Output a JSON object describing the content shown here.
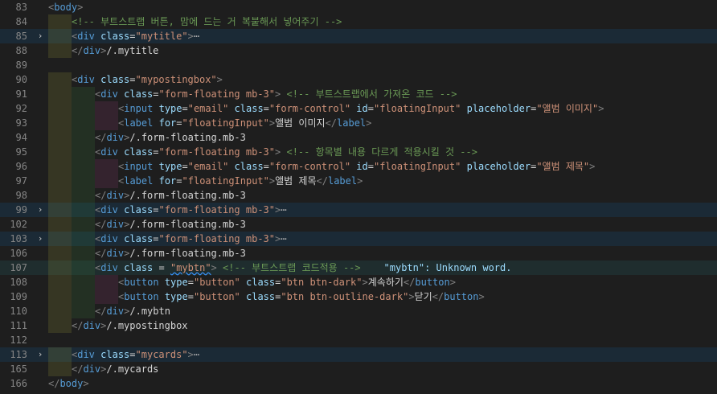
{
  "editor": {
    "lines": [
      {
        "num": "83",
        "fold": "",
        "indent": [],
        "tokens": [
          [
            "t-punc",
            "<"
          ],
          [
            "t-tag",
            "body"
          ],
          [
            "t-punc",
            ">"
          ]
        ]
      },
      {
        "num": "84",
        "fold": "",
        "indent": [
          "g1"
        ],
        "tokens": [
          [
            "t-com",
            "<!-- 부트스트랩 버튼, 맘에 드는 거 복붙해서 넣어주기 -->"
          ]
        ]
      },
      {
        "num": "85",
        "fold": "›",
        "hl": true,
        "indent": [
          "g1"
        ],
        "tokens": [
          [
            "t-punc",
            "<"
          ],
          [
            "t-tag",
            "div"
          ],
          [
            "t-text",
            " "
          ],
          [
            "t-attr",
            "class"
          ],
          [
            "t-text",
            "="
          ],
          [
            "t-str",
            "\"mytitle\""
          ],
          [
            "t-punc",
            ">"
          ],
          [
            "t-ellip",
            "⋯"
          ]
        ]
      },
      {
        "num": "88",
        "fold": "",
        "indent": [
          "g1"
        ],
        "tokens": [
          [
            "t-punc",
            "</"
          ],
          [
            "t-tag",
            "div"
          ],
          [
            "t-punc",
            ">"
          ],
          [
            "t-text",
            "/.mytitle"
          ]
        ]
      },
      {
        "num": "89",
        "fold": "",
        "indent": [],
        "tokens": []
      },
      {
        "num": "90",
        "fold": "",
        "indent": [
          "g1"
        ],
        "tokens": [
          [
            "t-punc",
            "<"
          ],
          [
            "t-tag",
            "div"
          ],
          [
            "t-text",
            " "
          ],
          [
            "t-attr",
            "class"
          ],
          [
            "t-text",
            "="
          ],
          [
            "t-str",
            "\"mypostingbox\""
          ],
          [
            "t-punc",
            ">"
          ]
        ]
      },
      {
        "num": "91",
        "fold": "",
        "indent": [
          "g1",
          "g2"
        ],
        "tokens": [
          [
            "t-punc",
            "<"
          ],
          [
            "t-tag",
            "div"
          ],
          [
            "t-text",
            " "
          ],
          [
            "t-attr",
            "class"
          ],
          [
            "t-text",
            "="
          ],
          [
            "t-str",
            "\"form-floating mb-3\""
          ],
          [
            "t-punc",
            ">"
          ],
          [
            "t-text",
            " "
          ],
          [
            "t-com",
            "<!-- 부트스트랩에서 가져온 코드 -->"
          ]
        ]
      },
      {
        "num": "92",
        "fold": "",
        "indent": [
          "g1",
          "g2",
          "g3"
        ],
        "tokens": [
          [
            "t-punc",
            "<"
          ],
          [
            "t-tag",
            "input"
          ],
          [
            "t-text",
            " "
          ],
          [
            "t-attr",
            "type"
          ],
          [
            "t-text",
            "="
          ],
          [
            "t-str",
            "\"email\""
          ],
          [
            "t-text",
            " "
          ],
          [
            "t-attr",
            "class"
          ],
          [
            "t-text",
            "="
          ],
          [
            "t-str",
            "\"form-control\""
          ],
          [
            "t-text",
            " "
          ],
          [
            "t-attr",
            "id"
          ],
          [
            "t-text",
            "="
          ],
          [
            "t-str",
            "\"floatingInput\""
          ],
          [
            "t-text",
            " "
          ],
          [
            "t-attr",
            "placeholder"
          ],
          [
            "t-text",
            "="
          ],
          [
            "t-str",
            "\"앨범 이미지\""
          ],
          [
            "t-punc",
            ">"
          ]
        ]
      },
      {
        "num": "93",
        "fold": "",
        "indent": [
          "g1",
          "g2",
          "g3"
        ],
        "tokens": [
          [
            "t-punc",
            "<"
          ],
          [
            "t-tag",
            "label"
          ],
          [
            "t-text",
            " "
          ],
          [
            "t-attr",
            "for"
          ],
          [
            "t-text",
            "="
          ],
          [
            "t-str",
            "\"floatingInput\""
          ],
          [
            "t-punc",
            ">"
          ],
          [
            "t-text",
            "앨범 이미지"
          ],
          [
            "t-punc",
            "</"
          ],
          [
            "t-tag",
            "label"
          ],
          [
            "t-punc",
            ">"
          ]
        ]
      },
      {
        "num": "94",
        "fold": "",
        "indent": [
          "g1",
          "g2"
        ],
        "tokens": [
          [
            "t-punc",
            "</"
          ],
          [
            "t-tag",
            "div"
          ],
          [
            "t-punc",
            ">"
          ],
          [
            "t-text",
            "/.form-floating.mb-3"
          ]
        ]
      },
      {
        "num": "95",
        "fold": "",
        "indent": [
          "g1",
          "g2"
        ],
        "tokens": [
          [
            "t-punc",
            "<"
          ],
          [
            "t-tag",
            "div"
          ],
          [
            "t-text",
            " "
          ],
          [
            "t-attr",
            "class"
          ],
          [
            "t-text",
            "="
          ],
          [
            "t-str",
            "\"form-floating mb-3\""
          ],
          [
            "t-punc",
            ">"
          ],
          [
            "t-text",
            " "
          ],
          [
            "t-com",
            "<!-- 항목별 내용 다르게 적용시킬 것 -->"
          ]
        ]
      },
      {
        "num": "96",
        "fold": "",
        "indent": [
          "g1",
          "g2",
          "g3"
        ],
        "tokens": [
          [
            "t-punc",
            "<"
          ],
          [
            "t-tag",
            "input"
          ],
          [
            "t-text",
            " "
          ],
          [
            "t-attr",
            "type"
          ],
          [
            "t-text",
            "="
          ],
          [
            "t-str",
            "\"email\""
          ],
          [
            "t-text",
            " "
          ],
          [
            "t-attr",
            "class"
          ],
          [
            "t-text",
            "="
          ],
          [
            "t-str",
            "\"form-control\""
          ],
          [
            "t-text",
            " "
          ],
          [
            "t-attr",
            "id"
          ],
          [
            "t-text",
            "="
          ],
          [
            "t-str",
            "\"floatingInput\""
          ],
          [
            "t-text",
            " "
          ],
          [
            "t-attr",
            "placeholder"
          ],
          [
            "t-text",
            "="
          ],
          [
            "t-str",
            "\"앨범 제목\""
          ],
          [
            "t-punc",
            ">"
          ]
        ]
      },
      {
        "num": "97",
        "fold": "",
        "indent": [
          "g1",
          "g2",
          "g3"
        ],
        "tokens": [
          [
            "t-punc",
            "<"
          ],
          [
            "t-tag",
            "label"
          ],
          [
            "t-text",
            " "
          ],
          [
            "t-attr",
            "for"
          ],
          [
            "t-text",
            "="
          ],
          [
            "t-str",
            "\"floatingInput\""
          ],
          [
            "t-punc",
            ">"
          ],
          [
            "t-text",
            "앨범 제목"
          ],
          [
            "t-punc",
            "</"
          ],
          [
            "t-tag",
            "label"
          ],
          [
            "t-punc",
            ">"
          ]
        ]
      },
      {
        "num": "98",
        "fold": "",
        "indent": [
          "g1",
          "g2"
        ],
        "tokens": [
          [
            "t-punc",
            "</"
          ],
          [
            "t-tag",
            "div"
          ],
          [
            "t-punc",
            ">"
          ],
          [
            "t-text",
            "/.form-floating.mb-3"
          ]
        ]
      },
      {
        "num": "99",
        "fold": "›",
        "hl": true,
        "indent": [
          "g1",
          "g2"
        ],
        "tokens": [
          [
            "t-punc",
            "<"
          ],
          [
            "t-tag",
            "div"
          ],
          [
            "t-text",
            " "
          ],
          [
            "t-attr",
            "class"
          ],
          [
            "t-text",
            "="
          ],
          [
            "t-str",
            "\"form-floating mb-3\""
          ],
          [
            "t-punc",
            ">"
          ],
          [
            "t-ellip",
            "⋯"
          ]
        ]
      },
      {
        "num": "102",
        "fold": "",
        "indent": [
          "g1",
          "g2"
        ],
        "tokens": [
          [
            "t-punc",
            "</"
          ],
          [
            "t-tag",
            "div"
          ],
          [
            "t-punc",
            ">"
          ],
          [
            "t-text",
            "/.form-floating.mb-3"
          ]
        ]
      },
      {
        "num": "103",
        "fold": "›",
        "hl": true,
        "indent": [
          "g1",
          "g2"
        ],
        "tokens": [
          [
            "t-punc",
            "<"
          ],
          [
            "t-tag",
            "div"
          ],
          [
            "t-text",
            " "
          ],
          [
            "t-attr",
            "class"
          ],
          [
            "t-text",
            "="
          ],
          [
            "t-str",
            "\"form-floating mb-3\""
          ],
          [
            "t-punc",
            ">"
          ],
          [
            "t-ellip",
            "⋯"
          ]
        ]
      },
      {
        "num": "106",
        "fold": "",
        "indent": [
          "g1",
          "g2"
        ],
        "tokens": [
          [
            "t-punc",
            "</"
          ],
          [
            "t-tag",
            "div"
          ],
          [
            "t-punc",
            ">"
          ],
          [
            "t-text",
            "/.form-floating.mb-3"
          ]
        ]
      },
      {
        "num": "107",
        "fold": "",
        "cur": true,
        "indent": [
          "g1",
          "g2"
        ],
        "tokens": [
          [
            "t-punc",
            "<"
          ],
          [
            "t-tag",
            "div"
          ],
          [
            "t-text",
            " "
          ],
          [
            "t-attr",
            "class"
          ],
          [
            "t-text",
            " = "
          ],
          [
            "t-str squiggle",
            "\"mybtn\""
          ],
          [
            "t-punc",
            ">"
          ],
          [
            "t-text",
            " "
          ],
          [
            "t-com",
            "<!-- 부트스트랩 코드적용 -->"
          ],
          [
            "t-text",
            "    "
          ],
          [
            "t-diag",
            "\"mybtn\": Unknown word."
          ]
        ]
      },
      {
        "num": "108",
        "fold": "",
        "indent": [
          "g1",
          "g2",
          "g3"
        ],
        "tokens": [
          [
            "t-punc",
            "<"
          ],
          [
            "t-tag",
            "button"
          ],
          [
            "t-text",
            " "
          ],
          [
            "t-attr",
            "type"
          ],
          [
            "t-text",
            "="
          ],
          [
            "t-str",
            "\"button\""
          ],
          [
            "t-text",
            " "
          ],
          [
            "t-attr",
            "class"
          ],
          [
            "t-text",
            "="
          ],
          [
            "t-str",
            "\"btn btn-dark\""
          ],
          [
            "t-punc",
            ">"
          ],
          [
            "t-text",
            "계속하기"
          ],
          [
            "t-punc",
            "</"
          ],
          [
            "t-tag",
            "button"
          ],
          [
            "t-punc",
            ">"
          ]
        ]
      },
      {
        "num": "109",
        "fold": "",
        "indent": [
          "g1",
          "g2",
          "g3"
        ],
        "tokens": [
          [
            "t-punc",
            "<"
          ],
          [
            "t-tag",
            "button"
          ],
          [
            "t-text",
            " "
          ],
          [
            "t-attr",
            "type"
          ],
          [
            "t-text",
            "="
          ],
          [
            "t-str",
            "\"button\""
          ],
          [
            "t-text",
            " "
          ],
          [
            "t-attr",
            "class"
          ],
          [
            "t-text",
            "="
          ],
          [
            "t-str",
            "\"btn btn-outline-dark\""
          ],
          [
            "t-punc",
            ">"
          ],
          [
            "t-text",
            "닫기"
          ],
          [
            "t-punc",
            "</"
          ],
          [
            "t-tag",
            "button"
          ],
          [
            "t-punc",
            ">"
          ]
        ]
      },
      {
        "num": "110",
        "fold": "",
        "indent": [
          "g1",
          "g2"
        ],
        "tokens": [
          [
            "t-punc",
            "</"
          ],
          [
            "t-tag",
            "div"
          ],
          [
            "t-punc",
            ">"
          ],
          [
            "t-text",
            "/.mybtn"
          ]
        ]
      },
      {
        "num": "111",
        "fold": "",
        "indent": [
          "g1"
        ],
        "tokens": [
          [
            "t-punc",
            "</"
          ],
          [
            "t-tag",
            "div"
          ],
          [
            "t-punc",
            ">"
          ],
          [
            "t-text",
            "/.mypostingbox"
          ]
        ]
      },
      {
        "num": "112",
        "fold": "",
        "indent": [],
        "tokens": []
      },
      {
        "num": "113",
        "fold": "›",
        "hl": true,
        "indent": [
          "g1"
        ],
        "tokens": [
          [
            "t-punc",
            "<"
          ],
          [
            "t-tag",
            "div"
          ],
          [
            "t-text",
            " "
          ],
          [
            "t-attr",
            "class"
          ],
          [
            "t-text",
            "="
          ],
          [
            "t-str",
            "\"mycards\""
          ],
          [
            "t-punc",
            ">"
          ],
          [
            "t-ellip",
            "⋯"
          ]
        ]
      },
      {
        "num": "165",
        "fold": "",
        "indent": [
          "g1"
        ],
        "tokens": [
          [
            "t-punc",
            "</"
          ],
          [
            "t-tag",
            "div"
          ],
          [
            "t-punc",
            ">"
          ],
          [
            "t-text",
            "/.mycards"
          ]
        ]
      },
      {
        "num": "166",
        "fold": "",
        "indent": [],
        "tokens": [
          [
            "t-punc",
            "</"
          ],
          [
            "t-tag",
            "body"
          ],
          [
            "t-punc",
            ">"
          ]
        ]
      }
    ]
  }
}
